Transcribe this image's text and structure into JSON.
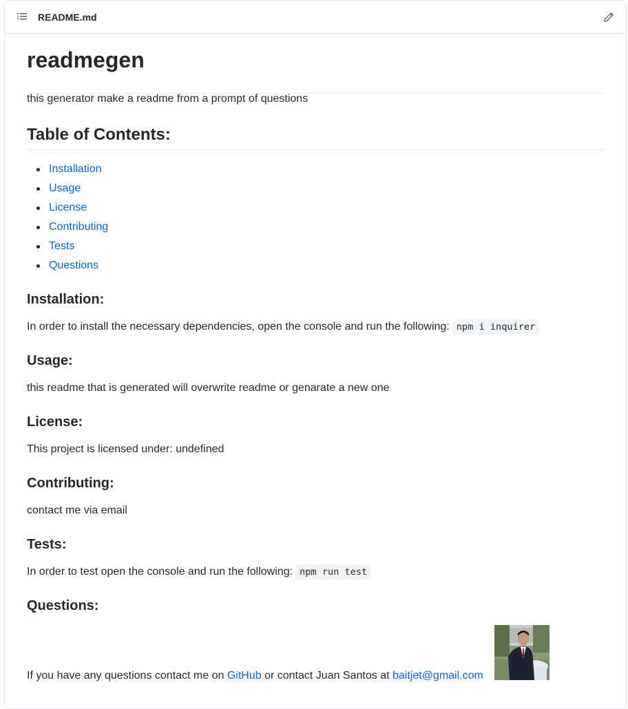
{
  "file": {
    "name": "README.md"
  },
  "readme": {
    "title": "readmegen",
    "description": "this generator make a readme from a prompt of questions",
    "toc_heading": "Table of Contents:",
    "toc": [
      "Installation",
      "Usage",
      "License",
      "Contributing",
      "Tests",
      "Questions"
    ],
    "installation": {
      "heading": "Installation:",
      "text": "In order to install the necessary dependencies, open the console and run the following:",
      "code": "npm i inquirer"
    },
    "usage": {
      "heading": "Usage:",
      "text": "this readme that is generated will overwrite readme or genarate a new one"
    },
    "license": {
      "heading": "License:",
      "text": "This project is licensed under: undefined"
    },
    "contributing": {
      "heading": "Contributing:",
      "text": "contact me via email"
    },
    "tests": {
      "heading": "Tests:",
      "text": "In order to test open the console and run the following:",
      "code": "npm run test"
    },
    "questions": {
      "heading": "Questions:",
      "text_before": "If you have any questions contact me on ",
      "github_link": "GitHub",
      "text_middle": " or contact Juan Santos at ",
      "email_link": "baitjet@gmail.com"
    }
  },
  "icons": {
    "toc": "list-icon",
    "edit": "pencil-icon"
  },
  "colors": {
    "link": "#0366d6",
    "text": "#24292e",
    "border": "#e1e4e8",
    "code_bg": "#f3f4f5"
  }
}
